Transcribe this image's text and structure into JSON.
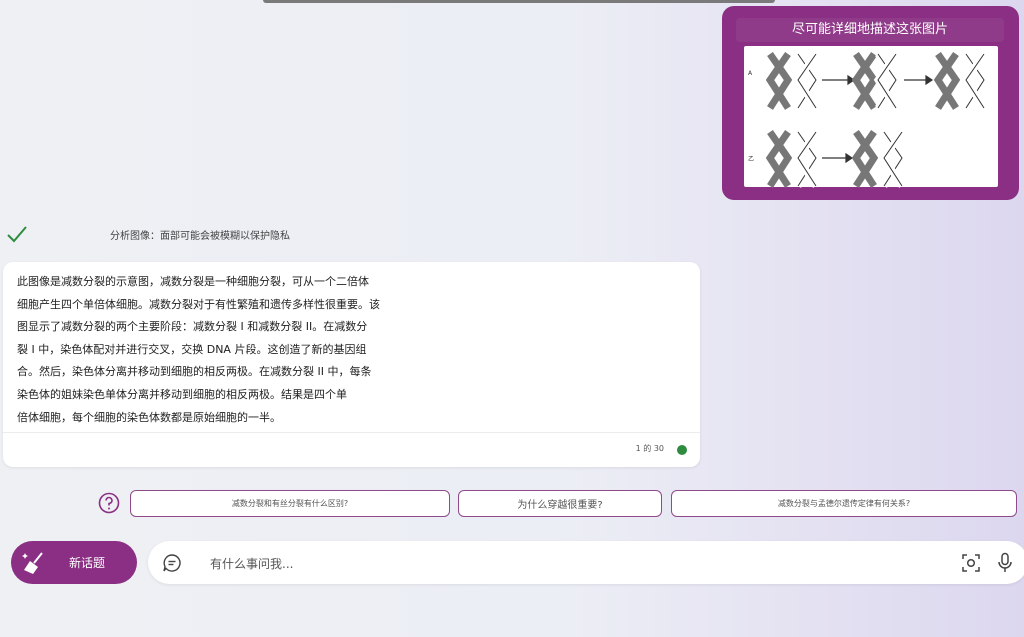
{
  "user_message": {
    "text": "尽可能详细地描述这张图片",
    "image_labels": {
      "row_a": "A",
      "row_b": "乙"
    }
  },
  "status": {
    "text": "分析图像：面部可能会被模糊以保护隐私"
  },
  "answer": {
    "lines": [
      "此图像是减数分裂的示意图，减数分裂是一种细胞分裂，可从一个二倍体",
      "细胞产生四个单倍体细胞。减数分裂对于有性繁殖和遗传多样性很重要。该",
      "图显示了减数分裂的两个主要阶段：减数分裂 I 和减数分裂 II。在减数分",
      "裂 I 中，染色体配对并进行交叉，交换 DNA 片段。这创造了新的基因组",
      "合。然后，染色体分离并移动到细胞的相反两极。在减数分裂 II 中，每条",
      "染色体的姐妹染色单体分离并移动到细胞的相反两极。结果是四个单",
      "倍体细胞，每个细胞的染色体数都是原始细胞的一半。"
    ],
    "page_count": "1 的 30",
    "status_color": "#2e8b3f"
  },
  "suggestions": [
    "减数分裂和有丝分裂有什么区别?",
    "为什么穿越很重要?",
    "减数分裂与孟德尔遗传定律有何关系?"
  ],
  "new_topic": {
    "label": "新话题"
  },
  "input": {
    "placeholder": "有什么事问我..."
  },
  "colors": {
    "accent": "#8a2f83",
    "status_ok": "#2e8b3f"
  }
}
